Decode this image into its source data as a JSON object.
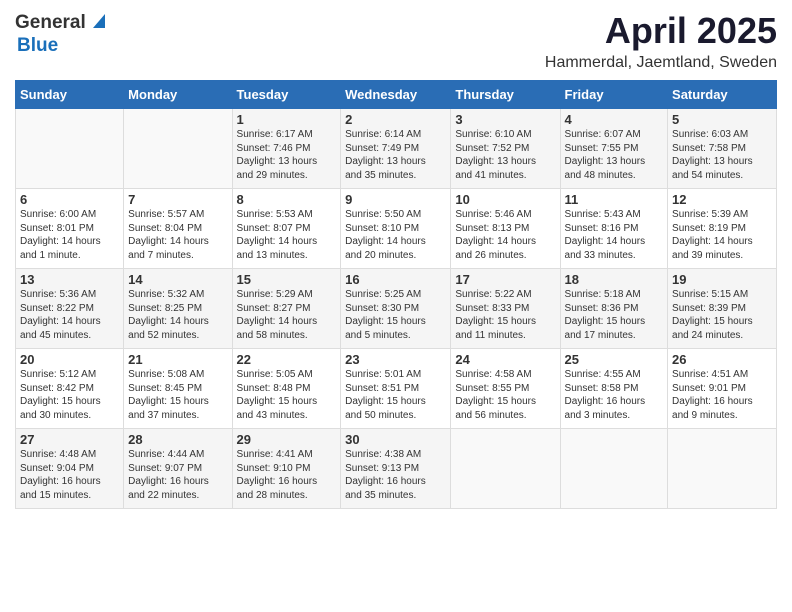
{
  "header": {
    "logo_general": "General",
    "logo_blue": "Blue",
    "month": "April 2025",
    "location": "Hammerdal, Jaemtland, Sweden"
  },
  "days_of_week": [
    "Sunday",
    "Monday",
    "Tuesday",
    "Wednesday",
    "Thursday",
    "Friday",
    "Saturday"
  ],
  "weeks": [
    [
      {
        "day": "",
        "info": ""
      },
      {
        "day": "",
        "info": ""
      },
      {
        "day": "1",
        "info": "Sunrise: 6:17 AM\nSunset: 7:46 PM\nDaylight: 13 hours\nand 29 minutes."
      },
      {
        "day": "2",
        "info": "Sunrise: 6:14 AM\nSunset: 7:49 PM\nDaylight: 13 hours\nand 35 minutes."
      },
      {
        "day": "3",
        "info": "Sunrise: 6:10 AM\nSunset: 7:52 PM\nDaylight: 13 hours\nand 41 minutes."
      },
      {
        "day": "4",
        "info": "Sunrise: 6:07 AM\nSunset: 7:55 PM\nDaylight: 13 hours\nand 48 minutes."
      },
      {
        "day": "5",
        "info": "Sunrise: 6:03 AM\nSunset: 7:58 PM\nDaylight: 13 hours\nand 54 minutes."
      }
    ],
    [
      {
        "day": "6",
        "info": "Sunrise: 6:00 AM\nSunset: 8:01 PM\nDaylight: 14 hours\nand 1 minute."
      },
      {
        "day": "7",
        "info": "Sunrise: 5:57 AM\nSunset: 8:04 PM\nDaylight: 14 hours\nand 7 minutes."
      },
      {
        "day": "8",
        "info": "Sunrise: 5:53 AM\nSunset: 8:07 PM\nDaylight: 14 hours\nand 13 minutes."
      },
      {
        "day": "9",
        "info": "Sunrise: 5:50 AM\nSunset: 8:10 PM\nDaylight: 14 hours\nand 20 minutes."
      },
      {
        "day": "10",
        "info": "Sunrise: 5:46 AM\nSunset: 8:13 PM\nDaylight: 14 hours\nand 26 minutes."
      },
      {
        "day": "11",
        "info": "Sunrise: 5:43 AM\nSunset: 8:16 PM\nDaylight: 14 hours\nand 33 minutes."
      },
      {
        "day": "12",
        "info": "Sunrise: 5:39 AM\nSunset: 8:19 PM\nDaylight: 14 hours\nand 39 minutes."
      }
    ],
    [
      {
        "day": "13",
        "info": "Sunrise: 5:36 AM\nSunset: 8:22 PM\nDaylight: 14 hours\nand 45 minutes."
      },
      {
        "day": "14",
        "info": "Sunrise: 5:32 AM\nSunset: 8:25 PM\nDaylight: 14 hours\nand 52 minutes."
      },
      {
        "day": "15",
        "info": "Sunrise: 5:29 AM\nSunset: 8:27 PM\nDaylight: 14 hours\nand 58 minutes."
      },
      {
        "day": "16",
        "info": "Sunrise: 5:25 AM\nSunset: 8:30 PM\nDaylight: 15 hours\nand 5 minutes."
      },
      {
        "day": "17",
        "info": "Sunrise: 5:22 AM\nSunset: 8:33 PM\nDaylight: 15 hours\nand 11 minutes."
      },
      {
        "day": "18",
        "info": "Sunrise: 5:18 AM\nSunset: 8:36 PM\nDaylight: 15 hours\nand 17 minutes."
      },
      {
        "day": "19",
        "info": "Sunrise: 5:15 AM\nSunset: 8:39 PM\nDaylight: 15 hours\nand 24 minutes."
      }
    ],
    [
      {
        "day": "20",
        "info": "Sunrise: 5:12 AM\nSunset: 8:42 PM\nDaylight: 15 hours\nand 30 minutes."
      },
      {
        "day": "21",
        "info": "Sunrise: 5:08 AM\nSunset: 8:45 PM\nDaylight: 15 hours\nand 37 minutes."
      },
      {
        "day": "22",
        "info": "Sunrise: 5:05 AM\nSunset: 8:48 PM\nDaylight: 15 hours\nand 43 minutes."
      },
      {
        "day": "23",
        "info": "Sunrise: 5:01 AM\nSunset: 8:51 PM\nDaylight: 15 hours\nand 50 minutes."
      },
      {
        "day": "24",
        "info": "Sunrise: 4:58 AM\nSunset: 8:55 PM\nDaylight: 15 hours\nand 56 minutes."
      },
      {
        "day": "25",
        "info": "Sunrise: 4:55 AM\nSunset: 8:58 PM\nDaylight: 16 hours\nand 3 minutes."
      },
      {
        "day": "26",
        "info": "Sunrise: 4:51 AM\nSunset: 9:01 PM\nDaylight: 16 hours\nand 9 minutes."
      }
    ],
    [
      {
        "day": "27",
        "info": "Sunrise: 4:48 AM\nSunset: 9:04 PM\nDaylight: 16 hours\nand 15 minutes."
      },
      {
        "day": "28",
        "info": "Sunrise: 4:44 AM\nSunset: 9:07 PM\nDaylight: 16 hours\nand 22 minutes."
      },
      {
        "day": "29",
        "info": "Sunrise: 4:41 AM\nSunset: 9:10 PM\nDaylight: 16 hours\nand 28 minutes."
      },
      {
        "day": "30",
        "info": "Sunrise: 4:38 AM\nSunset: 9:13 PM\nDaylight: 16 hours\nand 35 minutes."
      },
      {
        "day": "",
        "info": ""
      },
      {
        "day": "",
        "info": ""
      },
      {
        "day": "",
        "info": ""
      }
    ]
  ]
}
